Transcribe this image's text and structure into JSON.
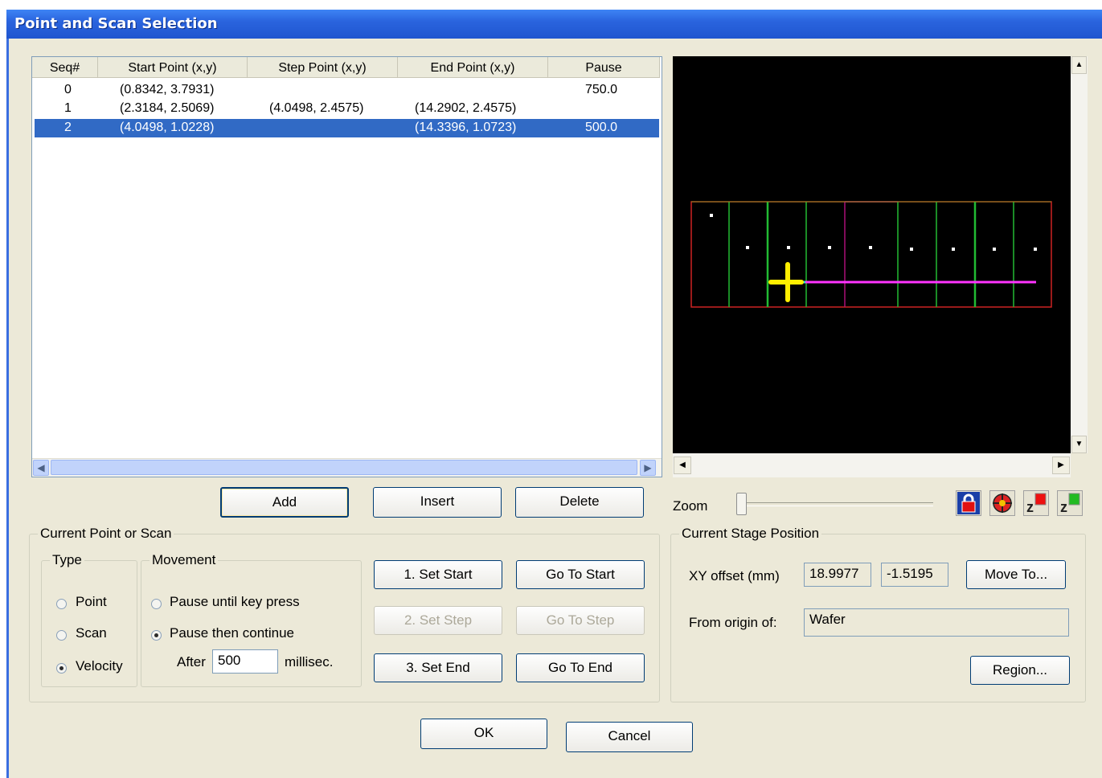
{
  "window": {
    "title": "Point and Scan Selection"
  },
  "table": {
    "columns": [
      "Seq#",
      "Start Point (x,y)",
      "Step Point (x,y)",
      "End Point (x,y)",
      "Pause"
    ],
    "rows": [
      {
        "seq": "0",
        "start": "(0.8342, 3.7931)",
        "step": "",
        "end": "",
        "pause": "750.0",
        "selected": false
      },
      {
        "seq": "1",
        "start": "(2.3184, 2.5069)",
        "step": "(4.0498, 2.4575)",
        "end": "(14.2902, 2.4575)",
        "pause": "",
        "selected": false
      },
      {
        "seq": "2",
        "start": "(4.0498, 1.0228)",
        "step": "",
        "end": "(14.3396, 1.0723)",
        "pause": "500.0",
        "selected": true
      }
    ]
  },
  "list_buttons": {
    "add": "Add",
    "insert": "Insert",
    "delete": "Delete"
  },
  "zoom": {
    "label": "Zoom",
    "value_fraction": 0.0
  },
  "current": {
    "group_label": "Current Point or Scan",
    "type": {
      "label": "Type",
      "options": [
        "Point",
        "Scan",
        "Velocity"
      ],
      "selected": "Velocity"
    },
    "movement": {
      "label": "Movement",
      "options": [
        "Pause until key press",
        "Pause then continue"
      ],
      "selected": "Pause then continue",
      "after_label": "After",
      "after_value": "500",
      "unit": "millisec."
    },
    "buttons": {
      "set_start": "1. Set Start",
      "set_step": "2. Set Step",
      "set_end": "3. Set End",
      "go_start": "Go To Start",
      "go_step": "Go To Step",
      "go_end": "Go To End"
    }
  },
  "stage": {
    "group_label": "Current Stage Position",
    "xy_label": "XY offset (mm)",
    "x": "18.9977",
    "y": "-1.5195",
    "move_to": "Move To...",
    "origin_label": "From origin of:",
    "origin_value": "Wafer",
    "region": "Region..."
  },
  "toolbar_icons": [
    "lock-icon",
    "crosshair-target-icon",
    "z-red-icon",
    "z-green-icon"
  ],
  "dialog": {
    "ok": "OK",
    "cancel": "Cancel"
  },
  "colors": {
    "selection": "#316ac5",
    "grid_outer": "#cc2222",
    "grid_lines": "#22bb33",
    "scan_line": "#ff33ff",
    "cursor": "#ffee00"
  }
}
